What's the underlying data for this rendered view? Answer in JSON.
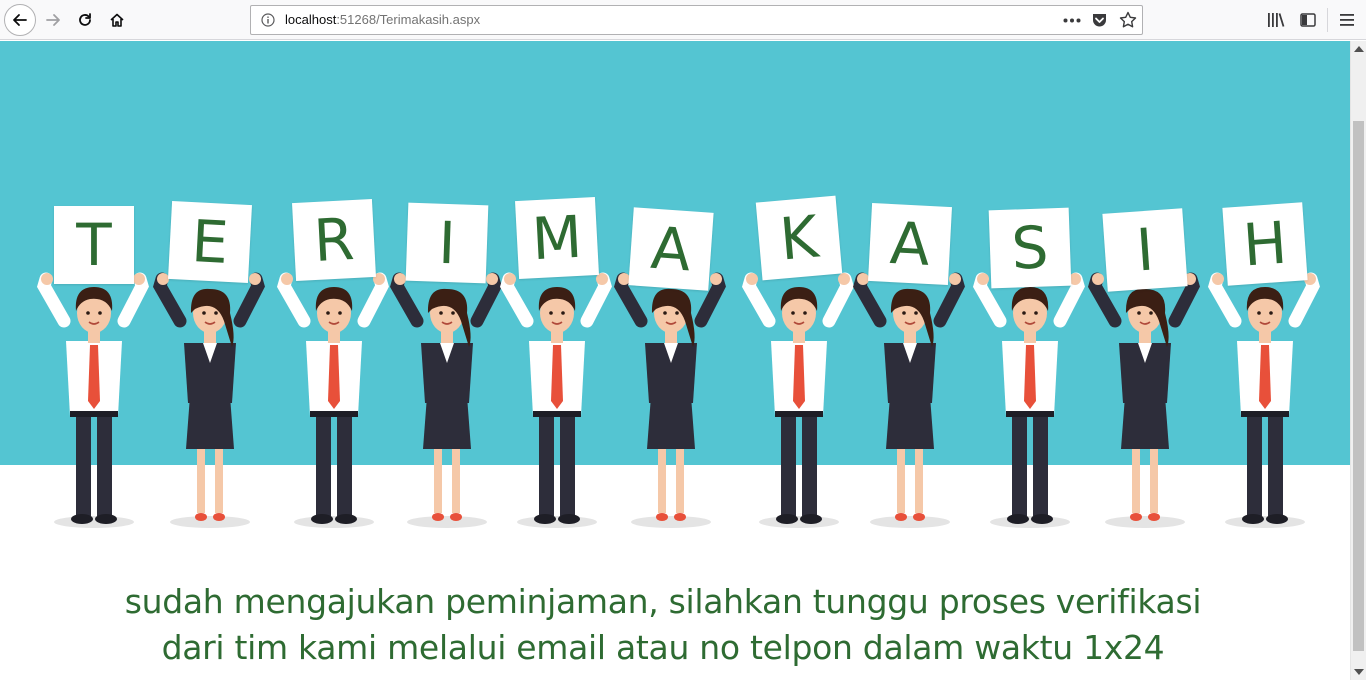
{
  "browser": {
    "url_host": "localhost",
    "url_path": ":51268/Terimakasih.aspx",
    "icons": [
      "back-icon",
      "forward-icon",
      "reload-icon",
      "home-icon",
      "info-icon",
      "more-icon",
      "pocket-icon",
      "bookmark-star-icon",
      "library-icon",
      "sidebar-icon",
      "menu-icon"
    ]
  },
  "banner": {
    "letters": [
      "T",
      "E",
      "R",
      "I",
      "M",
      "A",
      "K",
      "A",
      "S",
      "I",
      "H"
    ],
    "colors": {
      "sky": "#54c5d2",
      "letter": "#2e6b32",
      "shirt": "#ffffff",
      "suit": "#2d2d3a",
      "tie": "#e8503a",
      "skin": "#f5c8a8",
      "hair": "#3b1f14"
    }
  },
  "message": {
    "line1": "sudah mengajukan peminjaman, silahkan tunggu proses verifikasi",
    "line2": "dari tim kami melalui email atau no telpon dalam waktu 1x24"
  }
}
